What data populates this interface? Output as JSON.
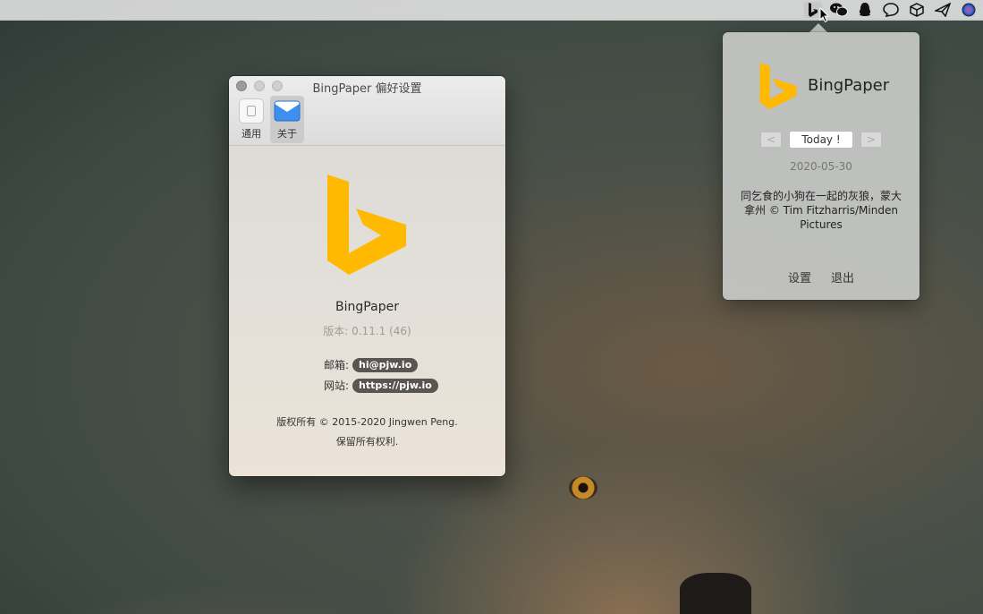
{
  "menubar": {
    "tray_icons": [
      "bingpaper-icon",
      "wechat-icon",
      "qq-icon",
      "chat-bubble-icon",
      "box-icon",
      "send-icon",
      "siri-icon"
    ]
  },
  "prefs_window": {
    "title": "BingPaper 偏好设置",
    "tabs": [
      {
        "label": "通用",
        "icon": "general-icon"
      },
      {
        "label": "关于",
        "icon": "about-icon"
      }
    ],
    "app_name": "BingPaper",
    "version": "版本: 0.11.1 (46)",
    "email_label": "邮箱:",
    "email": "hi@pjw.io",
    "site_label": "网站:",
    "site": "https://pjw.io",
    "copyright_line1": "版权所有 © 2015-2020 Jingwen Peng.",
    "copyright_line2": "保留所有权利."
  },
  "popover": {
    "brand": "BingPaper",
    "today_label": "Today !",
    "prev_label": "<",
    "next_label": ">",
    "date": "2020-05-30",
    "description": "同乞食的小狗在一起的灰狼，蒙大拿州 © Tim Fitzharris/Minden Pictures",
    "settings_label": "设置",
    "quit_label": "退出"
  },
  "colors": {
    "bing_yellow": "#ffb900",
    "menubar_bg": "#ebebeb",
    "pill_bg": "#5a5550"
  }
}
